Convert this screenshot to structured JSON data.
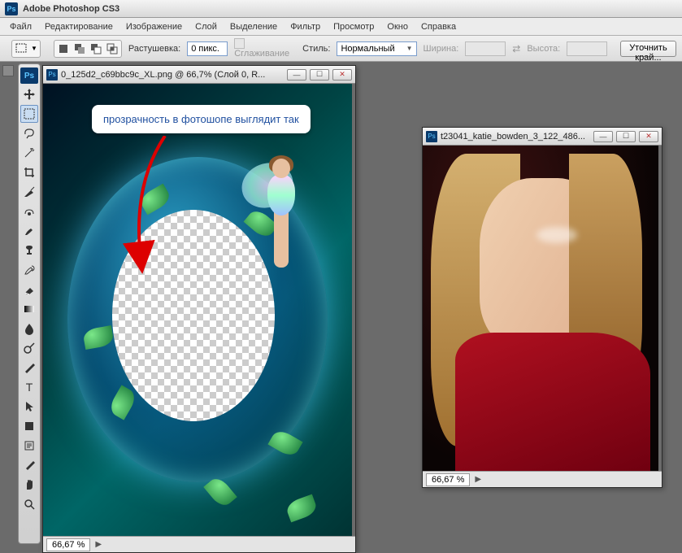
{
  "app": {
    "title": "Adobe Photoshop CS3"
  },
  "menu": [
    "Файл",
    "Редактирование",
    "Изображение",
    "Слой",
    "Выделение",
    "Фильтр",
    "Просмотр",
    "Окно",
    "Справка"
  ],
  "options": {
    "feather_label": "Растушевка:",
    "feather_value": "0 пикс.",
    "antialias_label": "Сглаживание",
    "style_label": "Стиль:",
    "style_value": "Нормальный",
    "width_label": "Ширина:",
    "width_value": "",
    "height_label": "Высота:",
    "height_value": "",
    "refine_btn": "Уточнить край..."
  },
  "doc1": {
    "title": "0_125d2_c69bbc9c_XL.png @ 66,7% (Слой 0, R...",
    "tooltip": "прозрачность в фотошопе выглядит так",
    "zoom": "66,67 %"
  },
  "doc2": {
    "title": "t23041_katie_bowden_3_122_486...",
    "zoom": "66,67 %"
  },
  "tools": [
    {
      "name": "move-tool",
      "glyph": "move"
    },
    {
      "name": "marquee-tool",
      "glyph": "marquee",
      "active": true
    },
    {
      "name": "lasso-tool",
      "glyph": "lasso"
    },
    {
      "name": "magic-wand-tool",
      "glyph": "wand"
    },
    {
      "name": "crop-tool",
      "glyph": "crop"
    },
    {
      "name": "slice-tool",
      "glyph": "slice"
    },
    {
      "name": "healing-brush-tool",
      "glyph": "heal"
    },
    {
      "name": "brush-tool",
      "glyph": "brush"
    },
    {
      "name": "clone-stamp-tool",
      "glyph": "stamp"
    },
    {
      "name": "history-brush-tool",
      "glyph": "histbrush"
    },
    {
      "name": "eraser-tool",
      "glyph": "eraser"
    },
    {
      "name": "gradient-tool",
      "glyph": "gradient"
    },
    {
      "name": "blur-tool",
      "glyph": "blur"
    },
    {
      "name": "dodge-tool",
      "glyph": "dodge"
    },
    {
      "name": "pen-tool",
      "glyph": "pen"
    },
    {
      "name": "type-tool",
      "glyph": "type"
    },
    {
      "name": "path-selection-tool",
      "glyph": "pathsel"
    },
    {
      "name": "shape-tool",
      "glyph": "shape"
    },
    {
      "name": "notes-tool",
      "glyph": "notes"
    },
    {
      "name": "eyedropper-tool",
      "glyph": "eyedrop"
    },
    {
      "name": "hand-tool",
      "glyph": "hand"
    },
    {
      "name": "zoom-tool",
      "glyph": "zoom"
    }
  ]
}
